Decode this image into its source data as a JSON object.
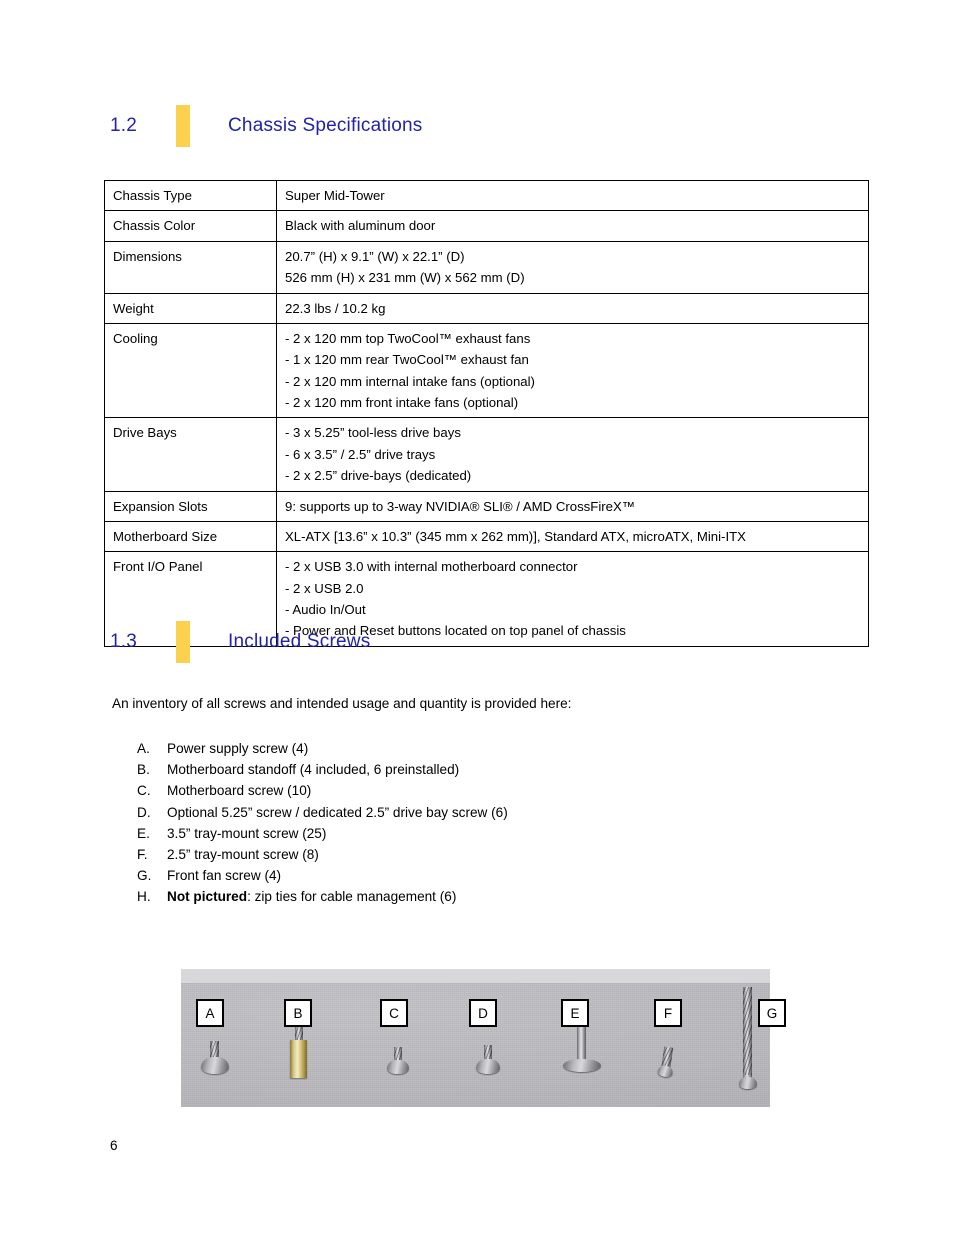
{
  "page": {
    "number": "6"
  },
  "sections": [
    {
      "number": "1.2",
      "title": "Chassis Specifications"
    },
    {
      "number": "1.3",
      "title": "Included Screws"
    }
  ],
  "spec_table": {
    "rows": [
      {
        "key": "Chassis Type",
        "values": [
          "Super Mid-Tower"
        ]
      },
      {
        "key": "Chassis Color",
        "values": [
          "Black with aluminum door"
        ]
      },
      {
        "key": "Dimensions",
        "values": [
          "20.7” (H) x 9.1” (W) x 22.1” (D)",
          "526 mm (H) x 231 mm (W) x 562 mm (D)"
        ]
      },
      {
        "key": "Weight",
        "values": [
          "22.3 lbs / 10.2 kg"
        ]
      },
      {
        "key": "Cooling",
        "values": [
          "- 2 x 120 mm top TwoCool™ exhaust fans",
          "- 1 x 120 mm rear TwoCool™ exhaust fan",
          "- 2 x 120 mm internal intake fans (optional)",
          "- 2 x 120 mm front intake fans (optional)"
        ]
      },
      {
        "key": "Drive Bays",
        "values": [
          "- 3 x 5.25” tool-less drive bays",
          "- 6 x 3.5” / 2.5” drive trays",
          "- 2 x 2.5” drive-bays (dedicated)"
        ]
      },
      {
        "key": "Expansion Slots",
        "values": [
          "9: supports up to 3-way NVIDIA® SLI® / AMD CrossFireX™"
        ]
      },
      {
        "key": "Motherboard Size",
        "values": [
          "XL-ATX [13.6” x 10.3” (345 mm x 262 mm)], Standard ATX, microATX, Mini-ITX"
        ]
      },
      {
        "key": "Front I/O Panel",
        "values": [
          "- 2 x USB 3.0 with internal motherboard connector",
          "- 2 x USB 2.0",
          "- Audio In/Out",
          "- Power and Reset buttons located on top panel of chassis"
        ]
      }
    ]
  },
  "screws": {
    "intro": "An inventory of all screws and intended usage and quantity is provided here:",
    "items": [
      {
        "letter": "A.",
        "text": "Power supply screw (4)",
        "bold_prefix": ""
      },
      {
        "letter": "B.",
        "text": "Motherboard standoff (4 included, 6 preinstalled)",
        "bold_prefix": ""
      },
      {
        "letter": "C.",
        "text": "Motherboard screw (10)",
        "bold_prefix": ""
      },
      {
        "letter": "D.",
        "text": "Optional 5.25” screw / dedicated 2.5” drive bay screw (6)",
        "bold_prefix": ""
      },
      {
        "letter": "E.",
        "text": "3.5” tray-mount screw (25)",
        "bold_prefix": ""
      },
      {
        "letter": "F.",
        "text": "2.5” tray-mount screw (8)",
        "bold_prefix": ""
      },
      {
        "letter": "G.",
        "text": "Front fan screw (4)",
        "bold_prefix": ""
      },
      {
        "letter": "H.",
        "text": ": zip ties for cable management (6)",
        "bold_prefix": "Not pictured"
      }
    ],
    "photo_labels": [
      "A",
      "B",
      "C",
      "D",
      "E",
      "F",
      "G"
    ]
  },
  "colors": {
    "heading_blue": "#2222AA",
    "accent_yellow": "#FCD14E",
    "table_border": "#000000",
    "photo_background": "#b9b8bd"
  }
}
